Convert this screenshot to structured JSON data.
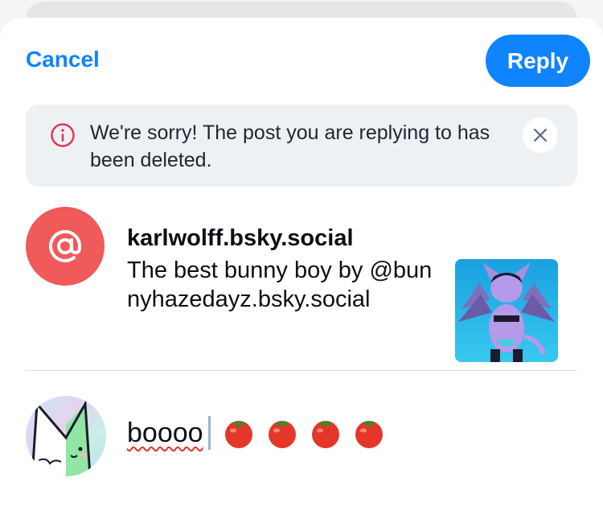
{
  "header": {
    "cancel_label": "Cancel",
    "reply_label": "Reply"
  },
  "banner": {
    "icon": "info-circle-icon",
    "message": "We're sorry! The post you are replying to has been deleted.",
    "close_icon": "close-icon"
  },
  "parent_post": {
    "avatar_icon": "at-sign-icon",
    "avatar_color": "#f05a5a",
    "author": "karlwolff.bsky.social",
    "text": "The best bunny boy by @bunnyhazedayz.bsky.social",
    "thumbnail": "character-illustration-thumbnail"
  },
  "composer": {
    "text": "boooo",
    "emoji": [
      "🍅",
      "🍅",
      "🍅",
      "🍅"
    ],
    "spellcheck_flagged": true
  },
  "colors": {
    "accent": "#1083fe",
    "banner_bg": "#eef1f3",
    "error": "#e0352b"
  }
}
